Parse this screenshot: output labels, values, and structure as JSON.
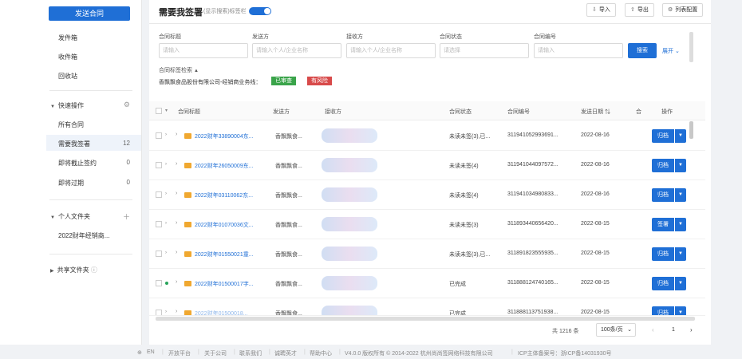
{
  "sidebar": {
    "send_button": "发送合同",
    "links": [
      "发件箱",
      "收件箱",
      "回收站"
    ],
    "quick_ops": {
      "title": "快速操作",
      "items": [
        {
          "label": "所有合同",
          "count": ""
        },
        {
          "label": "需要我签署",
          "count": "12"
        },
        {
          "label": "即将截止签约",
          "count": "0"
        },
        {
          "label": "即将过期",
          "count": "0"
        }
      ]
    },
    "personal_folder": {
      "title": "个人文件夹",
      "items": [
        "2022财年经销商..."
      ]
    },
    "shared_folder": {
      "title": "共享文件夹"
    }
  },
  "header": {
    "title": "需要我签署",
    "subtitle": "(显示搜索)标签栏",
    "buttons": {
      "import": "导入",
      "export": "导出",
      "columns": "列表配置"
    }
  },
  "filters": {
    "fields": [
      {
        "label": "合同标题",
        "placeholder": "请输入"
      },
      {
        "label": "发送方",
        "placeholder": "请输入个人/企业名称"
      },
      {
        "label": "接收方",
        "placeholder": "请输入个人/企业名称"
      },
      {
        "label": "合同状态",
        "placeholder": "请选择"
      },
      {
        "label": "合同编号",
        "placeholder": "请输入"
      }
    ],
    "search_label": "搜索",
    "expand_label": "展开"
  },
  "tags": {
    "title": "合同标签检索",
    "company": "香飘飘食品股份有限公司-经销商业务线：",
    "items": [
      {
        "label": "已审查",
        "color": "#3aa44a"
      },
      {
        "label": "有风险",
        "color": "#d84a4a"
      }
    ]
  },
  "table": {
    "columns": [
      "合同标题",
      "发送方",
      "接收方",
      "合同状态",
      "合同编号",
      "发送日期",
      "合",
      "操作"
    ],
    "rows": [
      {
        "title": "2022财年33890004东...",
        "sender": "香飘飘食...",
        "status": "未读未签(3),已...",
        "number": "311941052993691...",
        "date": "2022-08-16",
        "action": "归档"
      },
      {
        "title": "2022财年26050009东...",
        "sender": "香飘飘食...",
        "status": "未读未签(4)",
        "number": "311941044097572...",
        "date": "2022-08-16",
        "action": "归档"
      },
      {
        "title": "2022财年03110062东...",
        "sender": "香飘飘食...",
        "status": "未读未签(4)",
        "number": "311941034980833...",
        "date": "2022-08-16",
        "action": "归档"
      },
      {
        "title": "2022财年01070036文...",
        "sender": "香飘飘食...",
        "status": "未读未签(3)",
        "number": "311893440656420...",
        "date": "2022-08-15",
        "action": "签署"
      },
      {
        "title": "2022财年01550021童...",
        "sender": "香飘飘食...",
        "status": "未读未签(3),已...",
        "number": "311891823555935...",
        "date": "2022-08-15",
        "action": "归档"
      },
      {
        "title": "2022财年01500017字...",
        "sender": "香飘飘食...",
        "status": "已完成",
        "number": "311888124740165...",
        "date": "2022-08-15",
        "action": "归档"
      },
      {
        "title": "2022财年01500018...",
        "sender": "香飘飘食...",
        "status": "已完成",
        "number": "311888113751938...",
        "date": "2022-08-15",
        "action": "归档"
      }
    ]
  },
  "pagination": {
    "total": "共 1216 条",
    "page_size": "100条/页",
    "current": "1"
  },
  "footer": {
    "lang": "EN",
    "links": [
      "开放平台",
      "关于公司",
      "联系我们",
      "诚聘英才",
      "帮助中心"
    ],
    "copyright": "V4.0.0 版权所有 © 2014-2022 杭州尚尚签网络科技有限公司",
    "icp": "ICP主体备案号：浙ICP备14031930号"
  }
}
